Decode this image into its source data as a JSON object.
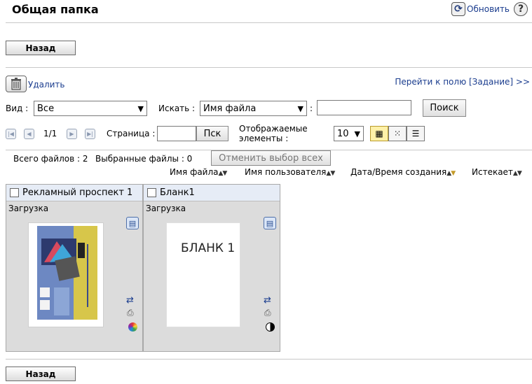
{
  "page": {
    "title": "Общая папка"
  },
  "header": {
    "refresh_label": "Обновить",
    "help_glyph": "?"
  },
  "back_label": "Назад",
  "toolbar": {
    "delete_label": "Удалить",
    "goto_label": "Перейти к полю [Задание] >>"
  },
  "filters": {
    "view_label": "Вид :",
    "view_value": "Все",
    "search_label": "Искать :",
    "search_field_value": "Имя файла",
    "colon": ":",
    "search_input_value": "",
    "search_button": "Поиск"
  },
  "pagination": {
    "page_info": "1/1",
    "page_label": "Страница :",
    "page_input_value": "",
    "go_button": "Пск",
    "display_label_line1": "Отображаемые",
    "display_label_line2": "элементы :",
    "display_value": "10"
  },
  "summary": {
    "total_files": "Всего файлов : 2",
    "selected_files": "Выбранные файлы : 0",
    "deselect_all": "Отменить выбор всех"
  },
  "sort_columns": [
    {
      "label": "Имя файла",
      "active": false
    },
    {
      "label": "Имя пользователя",
      "active": false
    },
    {
      "label": "Дата/Время создания",
      "active": true
    },
    {
      "label": "Истекает",
      "active": false
    }
  ],
  "files": [
    {
      "name": "Рекламный проспект 1",
      "status": "Загрузка",
      "thumb_type": "brochure",
      "color_mode_icon": "color-wheel-icon"
    },
    {
      "name": "Бланк1",
      "status": "Загрузка",
      "thumb_type": "blank",
      "thumb_text": "БЛАНК 1",
      "color_mode_icon": "bw-circle-icon"
    }
  ],
  "icons": {
    "refresh": "refresh-icon",
    "help": "help-icon",
    "delete": "trash-icon"
  },
  "colors": {
    "accent_link": "#1a3c8e",
    "header_bg": "#e6ecf6",
    "active_view": "#fff1a8"
  }
}
